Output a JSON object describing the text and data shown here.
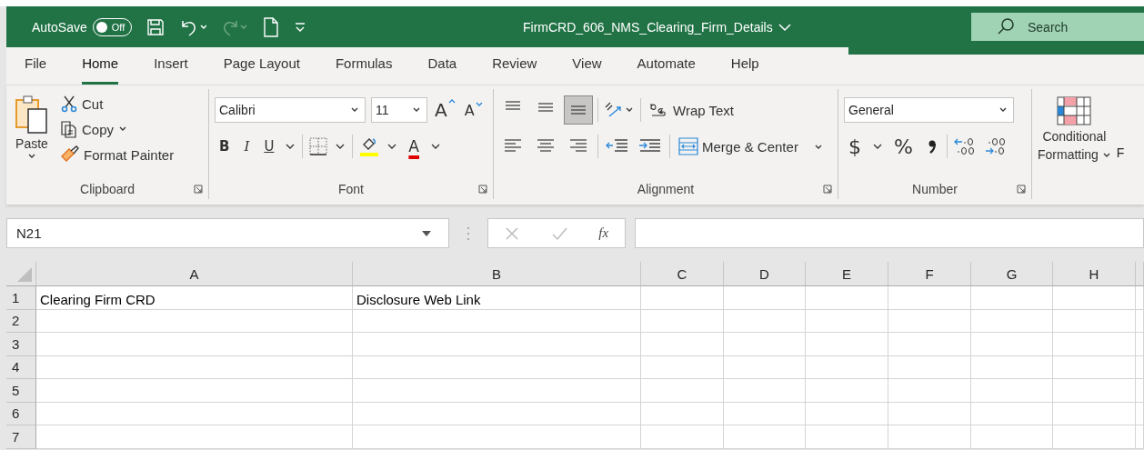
{
  "window": {
    "title": "FirmCRD_606_NMS_Clearing_Firm_Details"
  },
  "autosave": {
    "label": "AutoSave",
    "on": false,
    "state_text": "Off"
  },
  "search": {
    "placeholder": "Search"
  },
  "tabs": [
    {
      "label": "File",
      "selected": false
    },
    {
      "label": "Home",
      "selected": true
    },
    {
      "label": "Insert",
      "selected": false
    },
    {
      "label": "Page Layout",
      "selected": false
    },
    {
      "label": "Formulas",
      "selected": false
    },
    {
      "label": "Data",
      "selected": false
    },
    {
      "label": "Review",
      "selected": false
    },
    {
      "label": "View",
      "selected": false
    },
    {
      "label": "Automate",
      "selected": false
    },
    {
      "label": "Help",
      "selected": false
    }
  ],
  "clipboard": {
    "label": "Clipboard",
    "paste": "Paste",
    "cut": "Cut",
    "copy": "Copy",
    "format_painter": "Format Painter"
  },
  "font": {
    "label": "Font",
    "font_name": "Calibri",
    "font_size": "11",
    "bold": "B",
    "italic": "I",
    "underline": "U",
    "grow": "A",
    "shrink": "A",
    "font_color": "A"
  },
  "alignment": {
    "label": "Alignment",
    "vertical": [
      {
        "kind": "top",
        "selected": false
      },
      {
        "kind": "middle",
        "selected": false
      },
      {
        "kind": "bottom",
        "selected": true
      }
    ],
    "wrap_text": "Wrap Text",
    "merge": "Merge & Center"
  },
  "number": {
    "label": "Number",
    "format": "General",
    "currency": "$",
    "percent": "%"
  },
  "styles": {
    "conditional": "Conditional",
    "formatting": "Formatting",
    "cut_label": "F"
  },
  "formula_bar": {
    "name_box": "N21",
    "insert_function": "fx"
  },
  "sheet": {
    "columns": [
      "A",
      "B",
      "C",
      "D",
      "E",
      "F",
      "G",
      "H"
    ],
    "rows": [
      {
        "number": "1",
        "cells": [
          "Clearing Firm CRD",
          "Disclosure Web Link"
        ]
      },
      {
        "number": "2"
      },
      {
        "number": "3"
      },
      {
        "number": "4"
      },
      {
        "number": "5"
      },
      {
        "number": "6"
      },
      {
        "number": "7"
      }
    ]
  }
}
